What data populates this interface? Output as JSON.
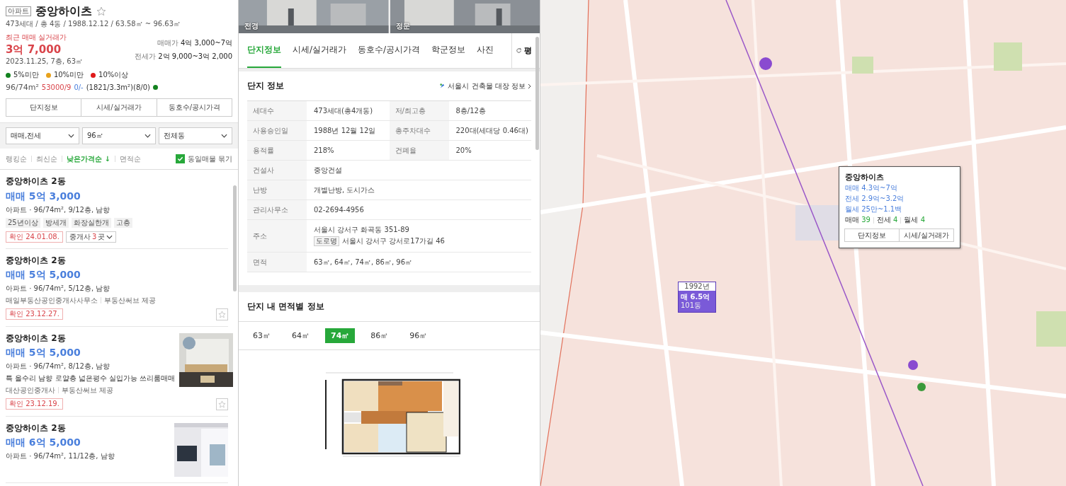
{
  "header": {
    "tag": "아파트",
    "title": "중앙하이츠",
    "summary": "473세대 / 총 4동 / 1988.12.12 / 63.58㎡ ~ 96.63㎡"
  },
  "recent": {
    "label": "최근 매매 실거래가",
    "price": "3억 7,000",
    "detail": "2023.11.25, 7층, 63㎡"
  },
  "ranges": [
    {
      "label": "매매가",
      "value": "4억 3,000~7억"
    },
    {
      "label": "전세가",
      "value": "2억 9,000~3억 2,000"
    }
  ],
  "legend": [
    {
      "label": "5%미만",
      "color": "#13821f"
    },
    {
      "label": "10%미만",
      "color": "#e8a21c"
    },
    {
      "label": "10%이상",
      "color": "#e01a1a"
    }
  ],
  "stat_line": {
    "area": "96/74m²",
    "price": "53000/9",
    "rent": "0/-",
    "extra": "(1821/3.3m²)(8/0)",
    "color": "#13821f"
  },
  "quick_tabs": [
    "단지정보",
    "시세/실거래가",
    "동호수/공시가격"
  ],
  "filters": [
    "매매,전세",
    "96㎡",
    "전체동"
  ],
  "sorts": [
    {
      "label": "랭킹순",
      "selected": false
    },
    {
      "label": "최신순",
      "selected": false
    },
    {
      "label": "낮은가격순 ↓",
      "selected": true
    },
    {
      "label": "면적순",
      "selected": false
    }
  ],
  "group_toggle": {
    "label": "동일매물 묶기",
    "checked": true
  },
  "listings": [
    {
      "title": "중앙하이츠 2동",
      "price": "매매 5억 3,000",
      "spec": "아파트 · 96/74m², 9/12층, 남향",
      "tags": [
        "25년이상",
        "방세개",
        "화장실한개",
        "고층"
      ],
      "confirmed": "확인 24.01.08.",
      "agents": {
        "label": "중개사",
        "count": "3",
        "unit": "곳"
      }
    },
    {
      "title": "중앙하이츠 2동",
      "price": "매매 5억 5,000",
      "spec": "아파트 · 96/74m², 5/12층, 남향",
      "source": [
        "매일부동산공인중개사사무소",
        "부동산써브 제공"
      ],
      "confirmed": "확인 23.12.27.",
      "starred": false
    },
    {
      "title": "중앙하이츠 2동",
      "price": "매매 5억 5,000",
      "spec": "아파트 · 96/74m², 8/12층, 남향",
      "desc": "특 올수리 남향 로얄층 넓은평수 실입가능 쓰리룸매매",
      "source": [
        "대산공인중개사",
        "부동산써브 제공"
      ],
      "confirmed": "확인 23.12.19.",
      "starred": false,
      "photo": {
        "kind": "picture"
      }
    },
    {
      "title": "중앙하이츠 2동",
      "price": "매매 6억 5,000",
      "spec": "아파트 · 96/74m², 11/12층, 남향",
      "photo": {
        "kind": "picture"
      }
    }
  ],
  "photos": [
    {
      "label": "전경"
    },
    {
      "label": "정문"
    }
  ],
  "tabs": [
    {
      "label": "단지정보",
      "selected": true
    },
    {
      "label": "시세/실거래가",
      "selected": false
    },
    {
      "label": "동호수/공시가격",
      "selected": false
    },
    {
      "label": "학군정보",
      "selected": false
    },
    {
      "label": "사진",
      "selected": false
    }
  ],
  "side_button": "평",
  "info": {
    "title": "단지 정보",
    "link": "서울시 건축물 대장 정보",
    "rows": [
      [
        {
          "label": "세대수",
          "value": "473세대(총4개동)"
        },
        {
          "label": "저/최고층",
          "value": "8층/12층"
        }
      ],
      [
        {
          "label": "사용승인일",
          "value": "1988년 12월 12일"
        },
        {
          "label": "총주차대수",
          "value": "220대(세대당 0.46대)"
        }
      ],
      [
        {
          "label": "용적률",
          "value": "218%"
        },
        {
          "label": "건폐율",
          "value": "20%"
        }
      ],
      [
        {
          "label": "건설사",
          "value": "중앙건설"
        }
      ],
      [
        {
          "label": "난방",
          "value": "개별난방, 도시가스"
        }
      ],
      [
        {
          "label": "관리사무소",
          "value": "02-2694-4956"
        }
      ],
      [
        {
          "label": "주소",
          "value": "서울시 강서구 화곡동 351-89",
          "road_tag": "도로명",
          "road": "서울시 강서구 강서로17가길 46"
        }
      ],
      [
        {
          "label": "면적",
          "value": "63㎡, 64㎡, 74㎡, 86㎡, 96㎡"
        }
      ]
    ]
  },
  "areas": {
    "title": "단지 내 면적별 정보",
    "options": [
      {
        "label": "63㎡",
        "selected": false
      },
      {
        "label": "64㎡",
        "selected": false
      },
      {
        "label": "74㎡",
        "selected": true
      },
      {
        "label": "86㎡",
        "selected": false
      },
      {
        "label": "96㎡",
        "selected": false
      }
    ]
  },
  "map": {
    "popup": {
      "title": "중앙하이츠",
      "prices": [
        "매매 4.3억~7억",
        "전세 2.9억~3.2억",
        "월세 25만~1.1백"
      ],
      "counts": [
        {
          "label": "매매",
          "value": "39"
        },
        {
          "label": "전세",
          "value": "4"
        },
        {
          "label": "월세",
          "value": "4"
        }
      ],
      "buttons": [
        "단지정보",
        "시세/실거래가"
      ]
    },
    "marker": {
      "year": "1992년",
      "price": "매 6.5억",
      "building": "101동"
    }
  }
}
